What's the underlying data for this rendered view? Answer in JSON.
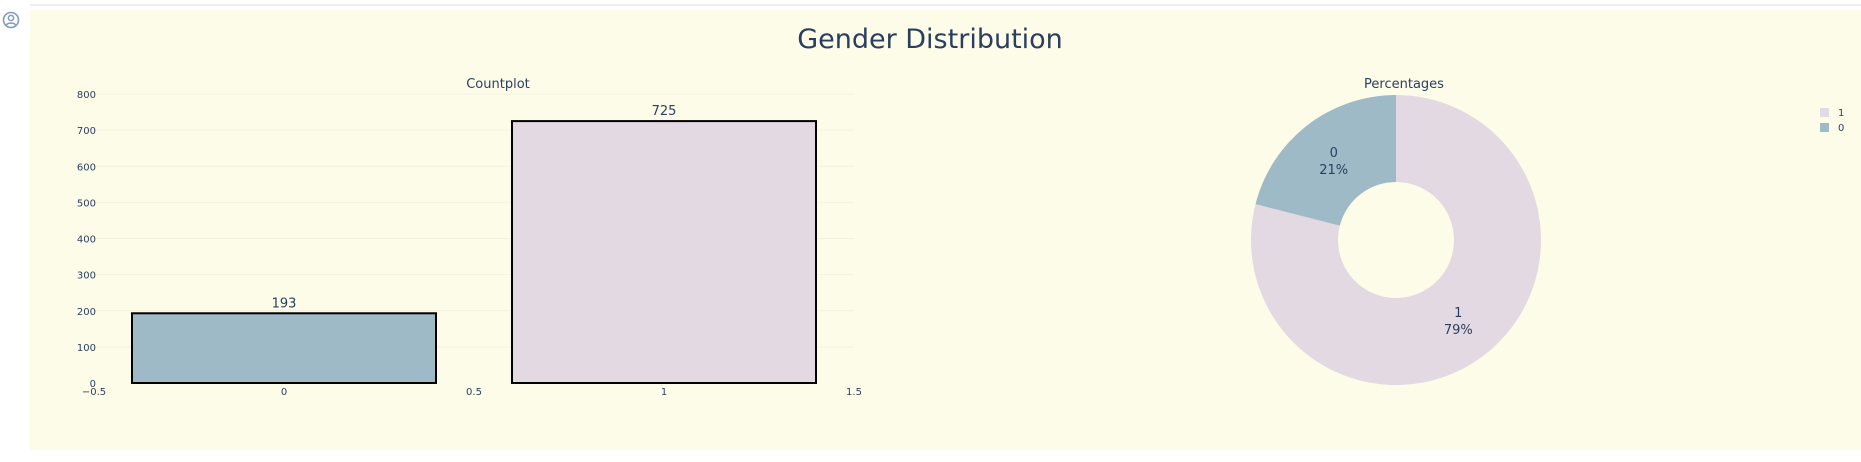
{
  "colors": {
    "plot_background": "#fdfce8",
    "gridline": "#f4f2dd",
    "text": "#2a3f5f",
    "bar_outline": "#000000",
    "avatar_icon": "#7f9cc0",
    "series_0": "#9ebac7",
    "series_1": "#e2d9e2"
  },
  "header": {
    "avatar_icon": "user-circle-icon"
  },
  "chart_data": [
    {
      "type": "bar",
      "title": "Gender Distribution",
      "subtitle": "Countplot",
      "x": [
        0,
        1
      ],
      "values": [
        193,
        725
      ],
      "data_labels": [
        "193",
        "725"
      ],
      "xlim": [
        -0.5,
        1.5
      ],
      "x_ticks": [
        "−0.5",
        "0",
        "0.5",
        "1",
        "1.5"
      ],
      "ylim": [
        0,
        800
      ],
      "y_ticks": [
        "0",
        "100",
        "200",
        "300",
        "400",
        "500",
        "600",
        "700",
        "800"
      ],
      "grid": true,
      "bar_outline": true
    },
    {
      "type": "pie",
      "subtitle": "Percentages",
      "hole": true,
      "slices": [
        {
          "label": "1",
          "value": 725,
          "percent": "79%",
          "color_key": "series_1"
        },
        {
          "label": "0",
          "value": 193,
          "percent": "21%",
          "color_key": "series_0"
        }
      ],
      "legend": {
        "placement": "top-right",
        "entries": [
          "1",
          "0"
        ]
      }
    }
  ]
}
